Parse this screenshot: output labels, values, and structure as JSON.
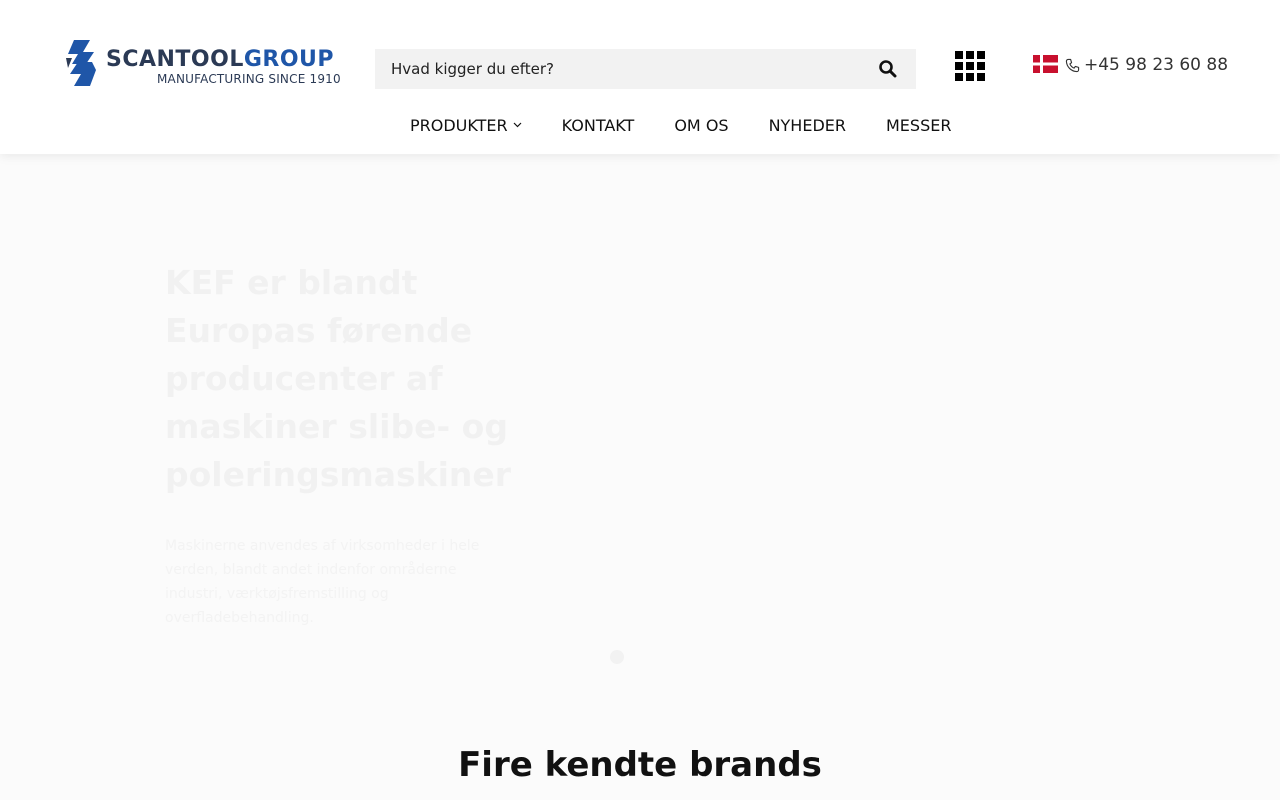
{
  "header": {
    "logo": {
      "name_part1": "SCANTOOL",
      "name_part2": "GROUP",
      "tagline": "MANUFACTURING SINCE 1910",
      "colors": {
        "dark": "#2b3a55",
        "blue": "#1f56a8"
      }
    },
    "search": {
      "placeholder": "Hvad kigger du efter?",
      "value": "",
      "icon": "search-icon"
    },
    "apps_icon": "grid-icon",
    "language_flag": "danish-flag-icon",
    "phone": {
      "icon": "phone-icon",
      "text": "+45 98 23 60 88"
    }
  },
  "nav": {
    "items": [
      {
        "label": "PRODUKTER",
        "has_dropdown": true
      },
      {
        "label": "KONTAKT"
      },
      {
        "label": "OM OS"
      },
      {
        "label": "NYHEDER"
      },
      {
        "label": "MESSER"
      }
    ]
  },
  "hero": {
    "title": "KEF er blandt Europas førende producenter af maskiner slibe- og poleringsmaskiner",
    "text": "Maskinerne anvendes af virksomheder i hele verden, blandt andet indenfor områderne industri, værktøjsfremstilling og overfladebehandling."
  },
  "sections": {
    "brands_title": "Fire kendte brands"
  },
  "colors": {
    "flag_red": "#c8102e",
    "flag_white": "#ffffff",
    "text": "#111111",
    "search_bg": "#f2f2f2"
  }
}
